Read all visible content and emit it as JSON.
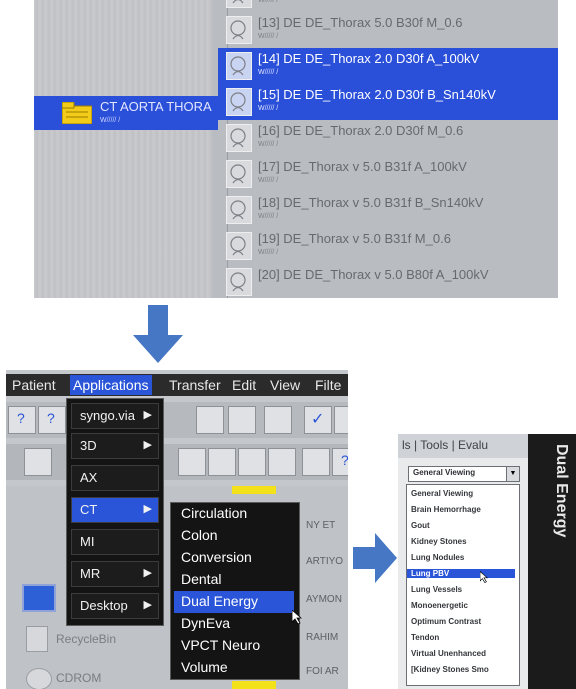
{
  "top_panel": {
    "study": {
      "name": "CT AORTA THORA",
      "sub": "W/////  /"
    },
    "series": [
      {
        "name": "",
        "sub": "W/////  /",
        "selected": false
      },
      {
        "name": "[13] DE  DE_Thorax  5.0  B30f  M_0.6",
        "sub": "W/////  /",
        "selected": false
      },
      {
        "name": "[14] DE  DE_Thorax  2.0  D30f  A_100kV",
        "sub": "W/////  /",
        "selected": true
      },
      {
        "name": "[15] DE  DE_Thorax  2.0  D30f  B_Sn140kV",
        "sub": "W/////  /",
        "selected": true
      },
      {
        "name": "[16] DE  DE_Thorax  2.0  D30f  M_0.6",
        "sub": "W/////  /",
        "selected": false
      },
      {
        "name": "[17] DE_Thorax v  5.0  B31f  A_100kV",
        "sub": "W/////  /",
        "selected": false
      },
      {
        "name": "[18] DE_Thorax v  5.0  B31f  B_Sn140kV",
        "sub": "W/////  /",
        "selected": false
      },
      {
        "name": "[19] DE_Thorax v  5.0  B31f  M_0.6",
        "sub": "W/////  /",
        "selected": false
      },
      {
        "name": "[20] DE  DE_Thorax v  5.0  B80f  A_100kV",
        "sub": "",
        "selected": false
      }
    ]
  },
  "menubar": {
    "items": [
      "Patient",
      "Applications",
      "Transfer",
      "Edit",
      "View",
      "Filte"
    ],
    "active": "Applications"
  },
  "applications_menu": {
    "items": [
      "syngo.via",
      "3D",
      "AX",
      "CT",
      "MI",
      "MR",
      "Desktop"
    ],
    "selected": "CT"
  },
  "ct_submenu": {
    "items": [
      "Circulation",
      "Colon",
      "Conversion",
      "Dental",
      "Dual Energy",
      "DynEva",
      "VPCT Neuro",
      "Volume"
    ],
    "selected": "Dual Energy"
  },
  "patient_list": {
    "lines": [
      "NY ET",
      "ARTIYO",
      "AYMON",
      "RAHIM",
      "FOI AR"
    ]
  },
  "desktop": {
    "recycle_label": "RecycleBin",
    "cdrom_label": "CDROM"
  },
  "dual_energy_panel": {
    "title": "Dual Energy",
    "tabs": "ls  |  Tools  |  Evalu",
    "combo_value": "General Viewing",
    "options": [
      "General Viewing",
      "Brain Hemorrhage",
      "Gout",
      "Kidney Stones",
      "Lung Nodules",
      "Lung PBV",
      "Lung Vessels",
      "Monoenergetic",
      "Optimum Contrast",
      "Tendon",
      "Virtual Unenhanced",
      "[Kidney Stones Smo"
    ],
    "selected": "Lung PBV"
  },
  "colors": {
    "selection": "#2a55d8",
    "arrow": "#4577c4",
    "highlight_yellow": "#f3e21a"
  }
}
